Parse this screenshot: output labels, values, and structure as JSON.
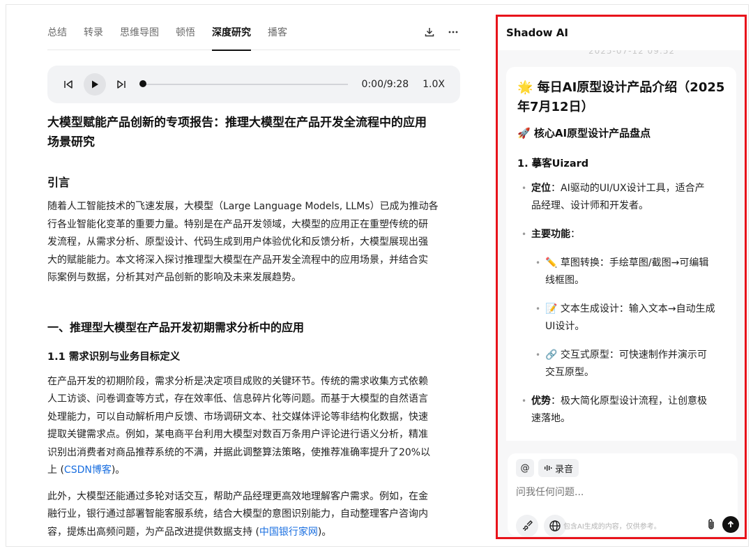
{
  "tabs": [
    "总结",
    "转录",
    "思维导图",
    "顿悟",
    "深度研究",
    "播客"
  ],
  "active_tab": 4,
  "player": {
    "time": "0:00/9:28",
    "speed": "1.0X",
    "progress": 0.0
  },
  "doc": {
    "title_line1": "大模型赋能产品创新的专项报告：推理大模型在产品开发全流程中的应用",
    "title_line2": "场景研究",
    "intro_heading": "引言",
    "intro_p": [
      "随着人工智能技术的飞速发展，大模型（Large Language Models, LLMs）已成为推动各",
      "行各业智能化变革的重要力量。特别是在产品开发领域，大模型的应用正在重塑传统的研",
      "发流程，从需求分析、原型设计、代码生成到用户体验优化和反馈分析，大模型展现出强",
      "大的赋能能力。本文将深入探讨推理型大模型在产品开发全流程中的应用场景，并结合实",
      "际案例与数据，分析其对产品创新的影响及未来发展趋势。"
    ],
    "section1_heading": "一、推理型大模型在产品开发初期需求分析中的应用",
    "section11_heading": "1.1 需求识别与业务目标定义",
    "p2": [
      "在产品开发的初期阶段，需求分析是决定项目成败的关键环节。传统的需求收集方式依赖",
      "人工访谈、问卷调查等方式，存在效率低、信息碎片化等问题。而基于大模型的自然语言",
      "处理能力，可以自动解析用户反馈、市场调研文本、社交媒体评论等非结构化数据，快速",
      "提取关键需求点。例如，某电商平台利用大模型对数百万条用户评论进行语义分析，精准",
      "识别出消费者对商品推荐系统的不满，并据此调整算法策略，使推荐准确率提升了20%以"
    ],
    "p2_last_pre": "上 (",
    "p2_link": "CSDN博客",
    "p2_last_post": ")。",
    "p3": [
      "此外，大模型还能通过多轮对话交互，帮助产品经理更高效地理解客户需求。例如，在金",
      "融行业，银行通过部署智能客服系统，结合大模型的意图识别能力，自动整理客户咨询内"
    ],
    "p3_last_pre": "容，提炼出高频问题，为产品改进提供数据支持 (",
    "p3_link": "中国银行家网",
    "p3_last_post": ")。"
  },
  "panel": {
    "title": "Shadow AI",
    "ghost_timestamp": "2025-07-12 09:52",
    "card": {
      "title_line1": "🌟 每日AI原型设计产品介绍（2025",
      "title_line2": "年7月12日）",
      "subtitle": "🚀 核心AI原型设计产品盘点",
      "product_heading": "1. 摹客Uizard",
      "positioning_label": "定位",
      "positioning_text_line1": "：AI驱动的UI/UX设计工具，适合产",
      "positioning_text_line2": "品经理、设计师和开发者。",
      "features_label": "主要功能",
      "features_colon": "：",
      "features": [
        {
          "line1": "✏️ 草图转换：手绘草图/截图→可编辑",
          "line2": "线框图。"
        },
        {
          "line1": "📝 文本生成设计：输入文本→自动生成",
          "line2": "UI设计。"
        },
        {
          "line1": "🔗 交互式原型：可快速制作并演示可",
          "line2": "交互原型。"
        }
      ],
      "advantage_label": "优势",
      "advantage_line1": "：极大简化原型设计流程，让创意极",
      "advantage_line2": "速落地。"
    },
    "composer": {
      "at_label": "@",
      "record_label": "录音",
      "placeholder": "问我任何问题...",
      "disclaimer": "包含AI生成的内容，仅供参考。"
    }
  },
  "colors": {
    "highlight_border": "#e8131b",
    "link": "#1a6fe0"
  }
}
